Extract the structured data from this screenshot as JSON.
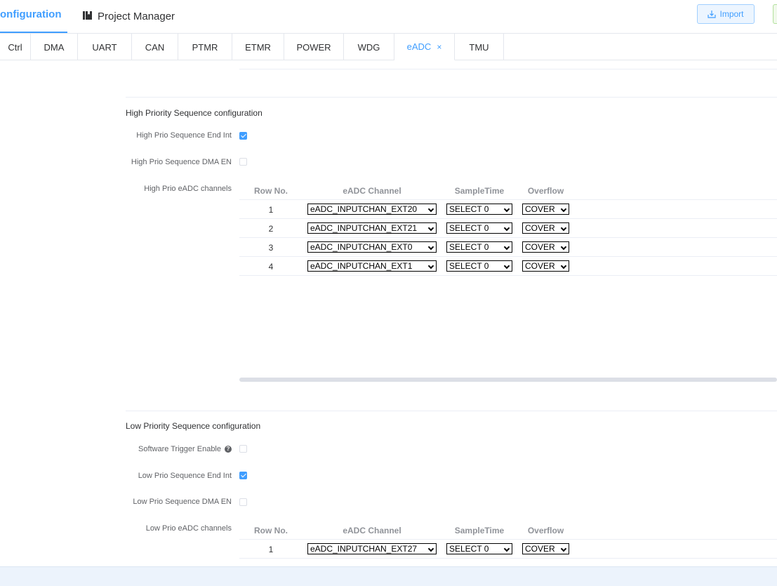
{
  "header": {
    "nav_configuration": "onfiguration",
    "nav_project_manager": "Project Manager",
    "import_label": "Import"
  },
  "tabs": [
    {
      "label": "Ctrl"
    },
    {
      "label": "DMA"
    },
    {
      "label": "UART"
    },
    {
      "label": "CAN"
    },
    {
      "label": "PTMR"
    },
    {
      "label": "ETMR"
    },
    {
      "label": "POWER"
    },
    {
      "label": "WDG"
    },
    {
      "label": "eADC",
      "active": true
    },
    {
      "label": "TMU"
    }
  ],
  "tab_close_glyph": "×",
  "high_prio": {
    "title": "High Priority Sequence configuration",
    "end_int_label": "High Prio Sequence End Int",
    "end_int_checked": true,
    "dma_en_label": "High Prio Sequence DMA EN",
    "dma_en_checked": false,
    "channels_label": "High Prio eADC channels",
    "columns": [
      "Row No.",
      "eADC Channel",
      "SampleTime",
      "Overflow"
    ],
    "rows": [
      {
        "no": "1",
        "channel": "eADC_INPUTCHAN_EXT20",
        "sample": "SELECT 0",
        "overflow": "COVER"
      },
      {
        "no": "2",
        "channel": "eADC_INPUTCHAN_EXT21",
        "sample": "SELECT 0",
        "overflow": "COVER"
      },
      {
        "no": "3",
        "channel": "eADC_INPUTCHAN_EXT0",
        "sample": "SELECT 0",
        "overflow": "COVER"
      },
      {
        "no": "4",
        "channel": "eADC_INPUTCHAN_EXT1",
        "sample": "SELECT 0",
        "overflow": "COVER"
      }
    ]
  },
  "low_prio": {
    "title": "Low Priority Sequence configuration",
    "sw_trigger_label": "Software Trigger Enable",
    "sw_trigger_checked": false,
    "help_glyph": "?",
    "end_int_label": "Low Prio Sequence End Int",
    "end_int_checked": true,
    "dma_en_label": "Low Prio Sequence DMA EN",
    "dma_en_checked": false,
    "channels_label": "Low Prio eADC channels",
    "columns": [
      "Row No.",
      "eADC Channel",
      "SampleTime",
      "Overflow"
    ],
    "rows": [
      {
        "no": "1",
        "channel": "eADC_INPUTCHAN_EXT27",
        "sample": "SELECT 0",
        "overflow": "COVER"
      }
    ]
  },
  "colors": {
    "accent": "#409eff",
    "border": "#e4e7ed",
    "footer": "#ecf3fc"
  }
}
